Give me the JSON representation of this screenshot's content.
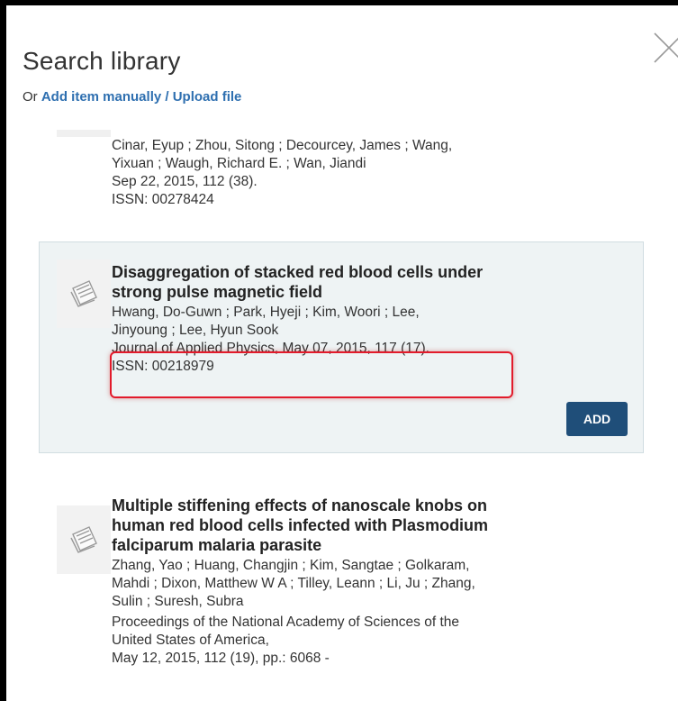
{
  "dialog": {
    "title": "Search library",
    "or_text": "Or",
    "add_manual_link": "Add item manually / Upload file"
  },
  "results": [
    {
      "authors": "Cinar, Eyup ; Zhou, Sitong ; Decourcey, James ; Wang, Yixuan ; Waugh, Richard E. ; Wan, Jiandi",
      "authors_lines": [
        "Cinar, Eyup ; Zhou, Sitong ; Decourcey, James ; Wang,",
        "Yixuan ; Waugh, Richard E. ; Wan, Jiandi"
      ],
      "date_info": "Sep 22, 2015,  112 (38).",
      "issn": "ISSN: 00278424"
    },
    {
      "title_lines": [
        "Disaggregation of stacked red blood cells under",
        "strong pulse magnetic field"
      ],
      "authors_lines": [
        "Hwang, Do-Guwn ; Park, Hyeji ; Kim, Woori ; Lee,",
        "Jinyoung ; Lee, Hyun Sook"
      ],
      "journal_info": "Journal of Applied Physics,  May 07, 2015,  117 (17).",
      "issn": "ISSN: 00218979",
      "add_label": "ADD"
    },
    {
      "title_lines": [
        "Multiple stiffening effects of nanoscale knobs on",
        "human red blood cells infected with Plasmodium",
        "falciparum malaria parasite"
      ],
      "authors_lines": [
        "Zhang, Yao ; Huang, Changjin ; Kim, Sangtae ; Golkaram,",
        "Mahdi ; Dixon, Matthew W A ; Tilley, Leann ; Li, Ju ; Zhang,",
        "Sulin ; Suresh, Subra"
      ],
      "journal_lines": [
        "Proceedings of the National Academy of Sciences of the",
        "United States of America,",
        "May 12, 2015,  112 (19),  pp.: 6068 -"
      ]
    }
  ],
  "icons": {
    "close": "close-icon",
    "document": "document-icon"
  },
  "colors": {
    "link": "#2e6fb0",
    "add_button": "#1f4e79",
    "highlight": "#e21b2b",
    "selected_bg": "#eef3f4"
  }
}
